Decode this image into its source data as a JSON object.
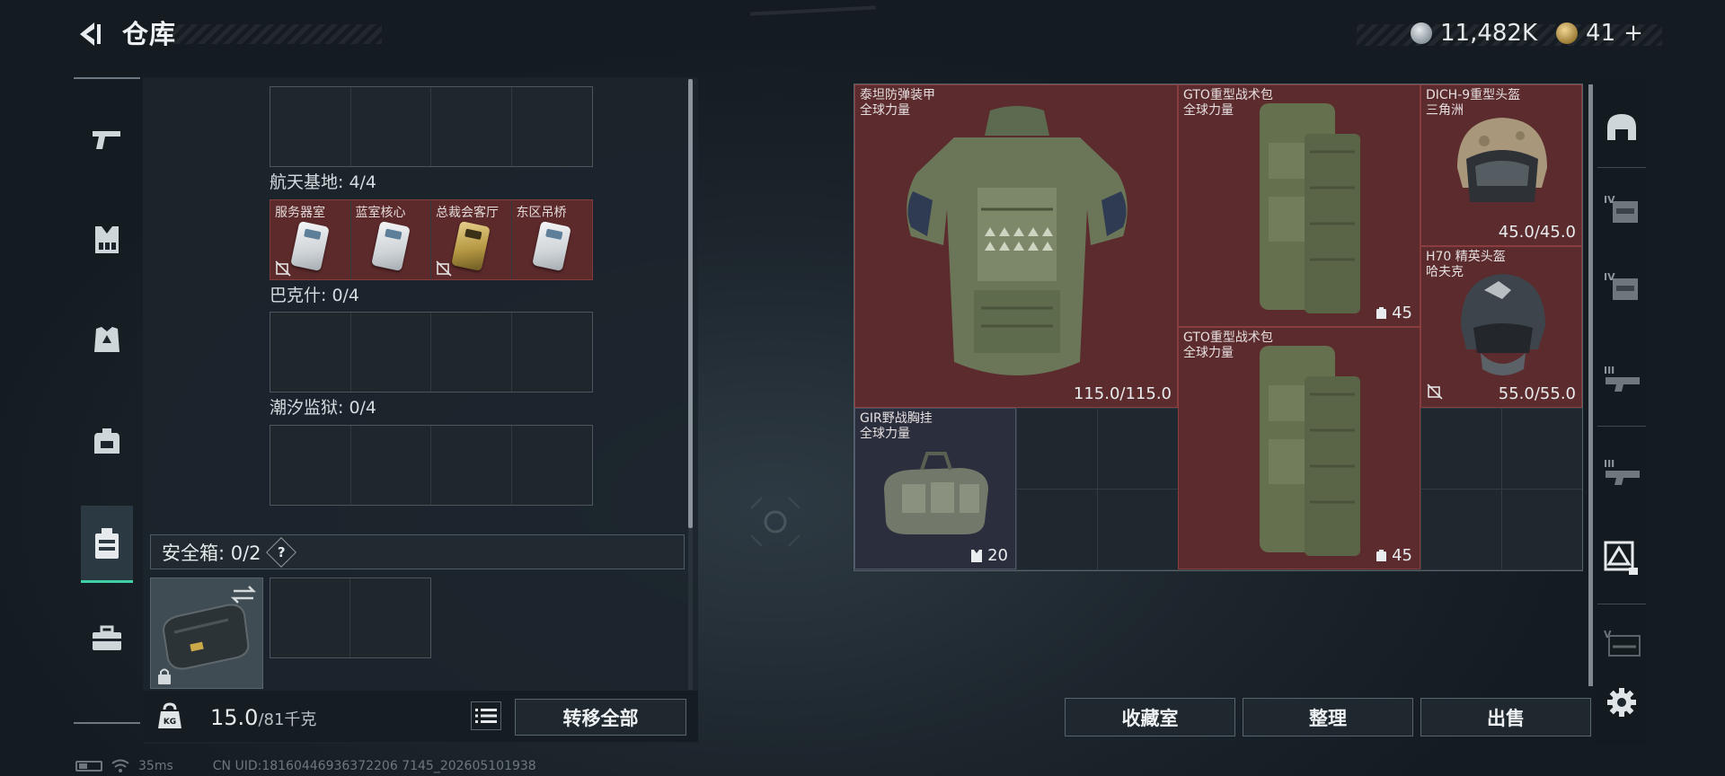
{
  "header": {
    "title": "仓库",
    "back_icon": "back-arrow-icon"
  },
  "currency": {
    "coin_amount": "11,482K",
    "coin_icon": "silver-coin-icon",
    "bonds_amount": "41",
    "bonds_icon": "gold-coin-icon",
    "add_label": "+"
  },
  "category_rail": [
    {
      "icon": "pistol-icon",
      "active": false
    },
    {
      "icon": "chest-rig-icon",
      "active": false
    },
    {
      "icon": "armor-vest-icon",
      "active": false
    },
    {
      "icon": "backpack-icon",
      "active": false
    },
    {
      "icon": "container-icon",
      "active": true
    },
    {
      "icon": "toolbox-icon",
      "active": false
    }
  ],
  "stash": {
    "rows": [
      {
        "label": "航天基地: 4/4",
        "slots": [
          {
            "name": "服务器室",
            "card": "silver",
            "no_drop": true
          },
          {
            "name": "蓝室核心",
            "card": "silver",
            "no_drop": false
          },
          {
            "name": "总裁会客厅",
            "card": "gold",
            "no_drop": true
          },
          {
            "name": "东区吊桥",
            "card": "silver",
            "no_drop": false
          }
        ]
      },
      {
        "label": "巴克什: 0/4"
      },
      {
        "label": "潮汐监狱: 0/4"
      }
    ],
    "secure_box": {
      "label": "安全箱: 0/2",
      "help": "?"
    },
    "weight": {
      "current": "15.0",
      "max": "/81千克"
    },
    "transfer_all": "转移全部"
  },
  "inventory": {
    "items": [
      {
        "name": "泰坦防弹装甲\n全球力量",
        "value": "115.0/115.0",
        "kind": "armor"
      },
      {
        "name": "GTO重型战术包\n全球力量",
        "value": "45",
        "kind": "backpack"
      },
      {
        "name": "DICH-9重型头盔\n三角洲",
        "value": "45.0/45.0",
        "kind": "helmet"
      },
      {
        "name": "H70 精英头盔\n哈夫克",
        "value": "55.0/55.0",
        "kind": "helmet2"
      },
      {
        "name": "GTO重型战术包\n全球力量",
        "value": "45",
        "kind": "backpack"
      },
      {
        "name": "GIR野战胸挂\n全球力量",
        "value": "20",
        "kind": "chestrig"
      }
    ],
    "buttons": {
      "collection": "收藏室",
      "organize": "整理",
      "sell": "出售"
    }
  },
  "right_rail": [
    {
      "icon": "helmet-slot-icon"
    },
    {
      "icon": "tier4-armor-icon",
      "label": "IV"
    },
    {
      "icon": "tier4-armor-icon",
      "label": "IV"
    },
    {
      "icon": "tier3-weapon-icon",
      "label": "III"
    },
    {
      "icon": "tier3-weapon-icon",
      "label": "III"
    },
    {
      "icon": "stash-filter-icon"
    },
    {
      "icon": "tier5-weapon-icon",
      "label": "V"
    },
    {
      "icon": "settings-gear-icon"
    }
  ],
  "status": {
    "latency": "35ms",
    "uid": "CN UID:18160446936372206 7145_202605101938"
  }
}
